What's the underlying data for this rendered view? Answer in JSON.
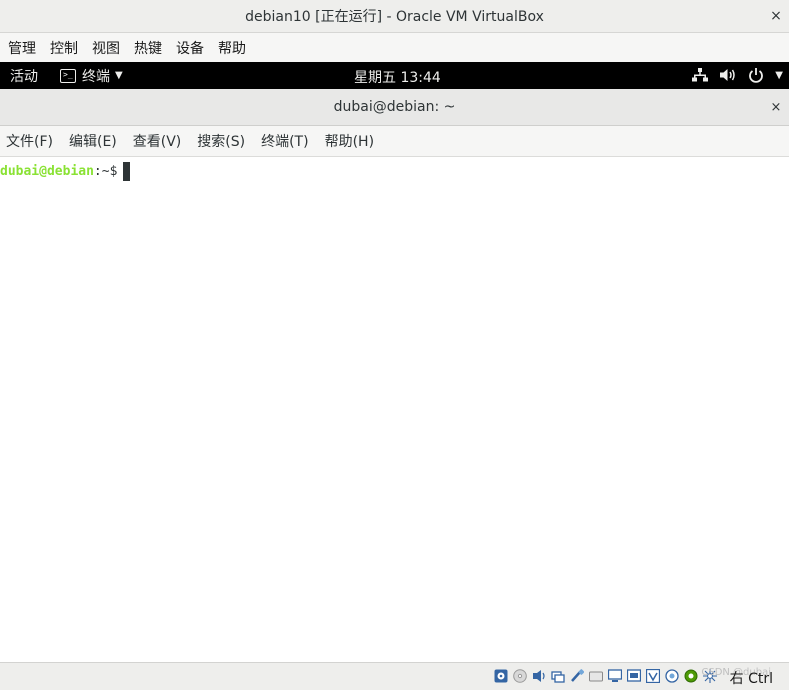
{
  "host_window": {
    "title": "debian10 [正在运行] - Oracle VM VirtualBox",
    "close_glyph": "×",
    "menu": [
      "管理",
      "控制",
      "视图",
      "热键",
      "设备",
      "帮助"
    ]
  },
  "guest_topbar": {
    "activities": "活动",
    "app_name": "终端",
    "app_caret": "▼",
    "clock": "星期五 13:44",
    "tray_caret": "▼"
  },
  "terminal": {
    "title": "dubai@debian: ~",
    "close_glyph": "×",
    "menu": [
      "文件(F)",
      "编辑(E)",
      "查看(V)",
      "搜索(S)",
      "终端(T)",
      "帮助(H)"
    ],
    "prompt_user": "dubai@debian",
    "prompt_path": ":~$"
  },
  "statusbar": {
    "host_key": "右 Ctrl",
    "watermark": "CSDN @dubai"
  },
  "colors": {
    "prompt_green": "#8ae234",
    "topbar_bg": "#000000"
  }
}
